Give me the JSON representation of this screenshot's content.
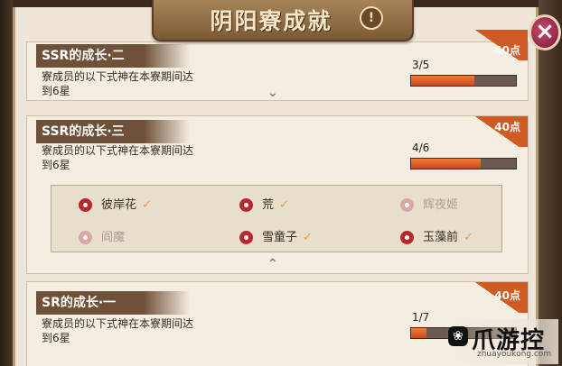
{
  "header": {
    "title": "阴阳寮成就",
    "info_icon": "!"
  },
  "close_label": "×",
  "cards": [
    {
      "title": "SSR的成长·二",
      "desc_line1": "寮成员的以下式神在本寮期间达",
      "desc_line2": "到6星",
      "reward": "40点",
      "progress_text": "3/5",
      "progress": 0.6
    },
    {
      "title": "SSR的成长·三",
      "desc_line1": "寮成员的以下式神在本寮期间达",
      "desc_line2": "到6星",
      "reward": "40点",
      "progress_text": "4/6",
      "progress": 0.6667,
      "shikigami": [
        {
          "name": "彼岸花",
          "done": true,
          "check": "✓"
        },
        {
          "name": "荒",
          "done": true,
          "check": "✓"
        },
        {
          "name": "辉夜姬",
          "done": false,
          "check": ""
        },
        {
          "name": "阎魔",
          "done": false,
          "check": ""
        },
        {
          "name": "雪童子",
          "done": true,
          "check": "✓"
        },
        {
          "name": "玉藻前",
          "done": true,
          "check": "✓"
        }
      ]
    },
    {
      "title": "SR的成长·一",
      "desc_line1": "寮成员的以下式神在本寮期间达",
      "desc_line2": "到6星",
      "reward": "40点",
      "progress_text": "1/7",
      "progress": 0.1429
    }
  ],
  "watermark": {
    "text": "爪游控",
    "sub": "zhuayoukong.com"
  },
  "colors": {
    "accent": "#d05a24",
    "banner": "#8a6a44",
    "close": "#a02a4a"
  }
}
